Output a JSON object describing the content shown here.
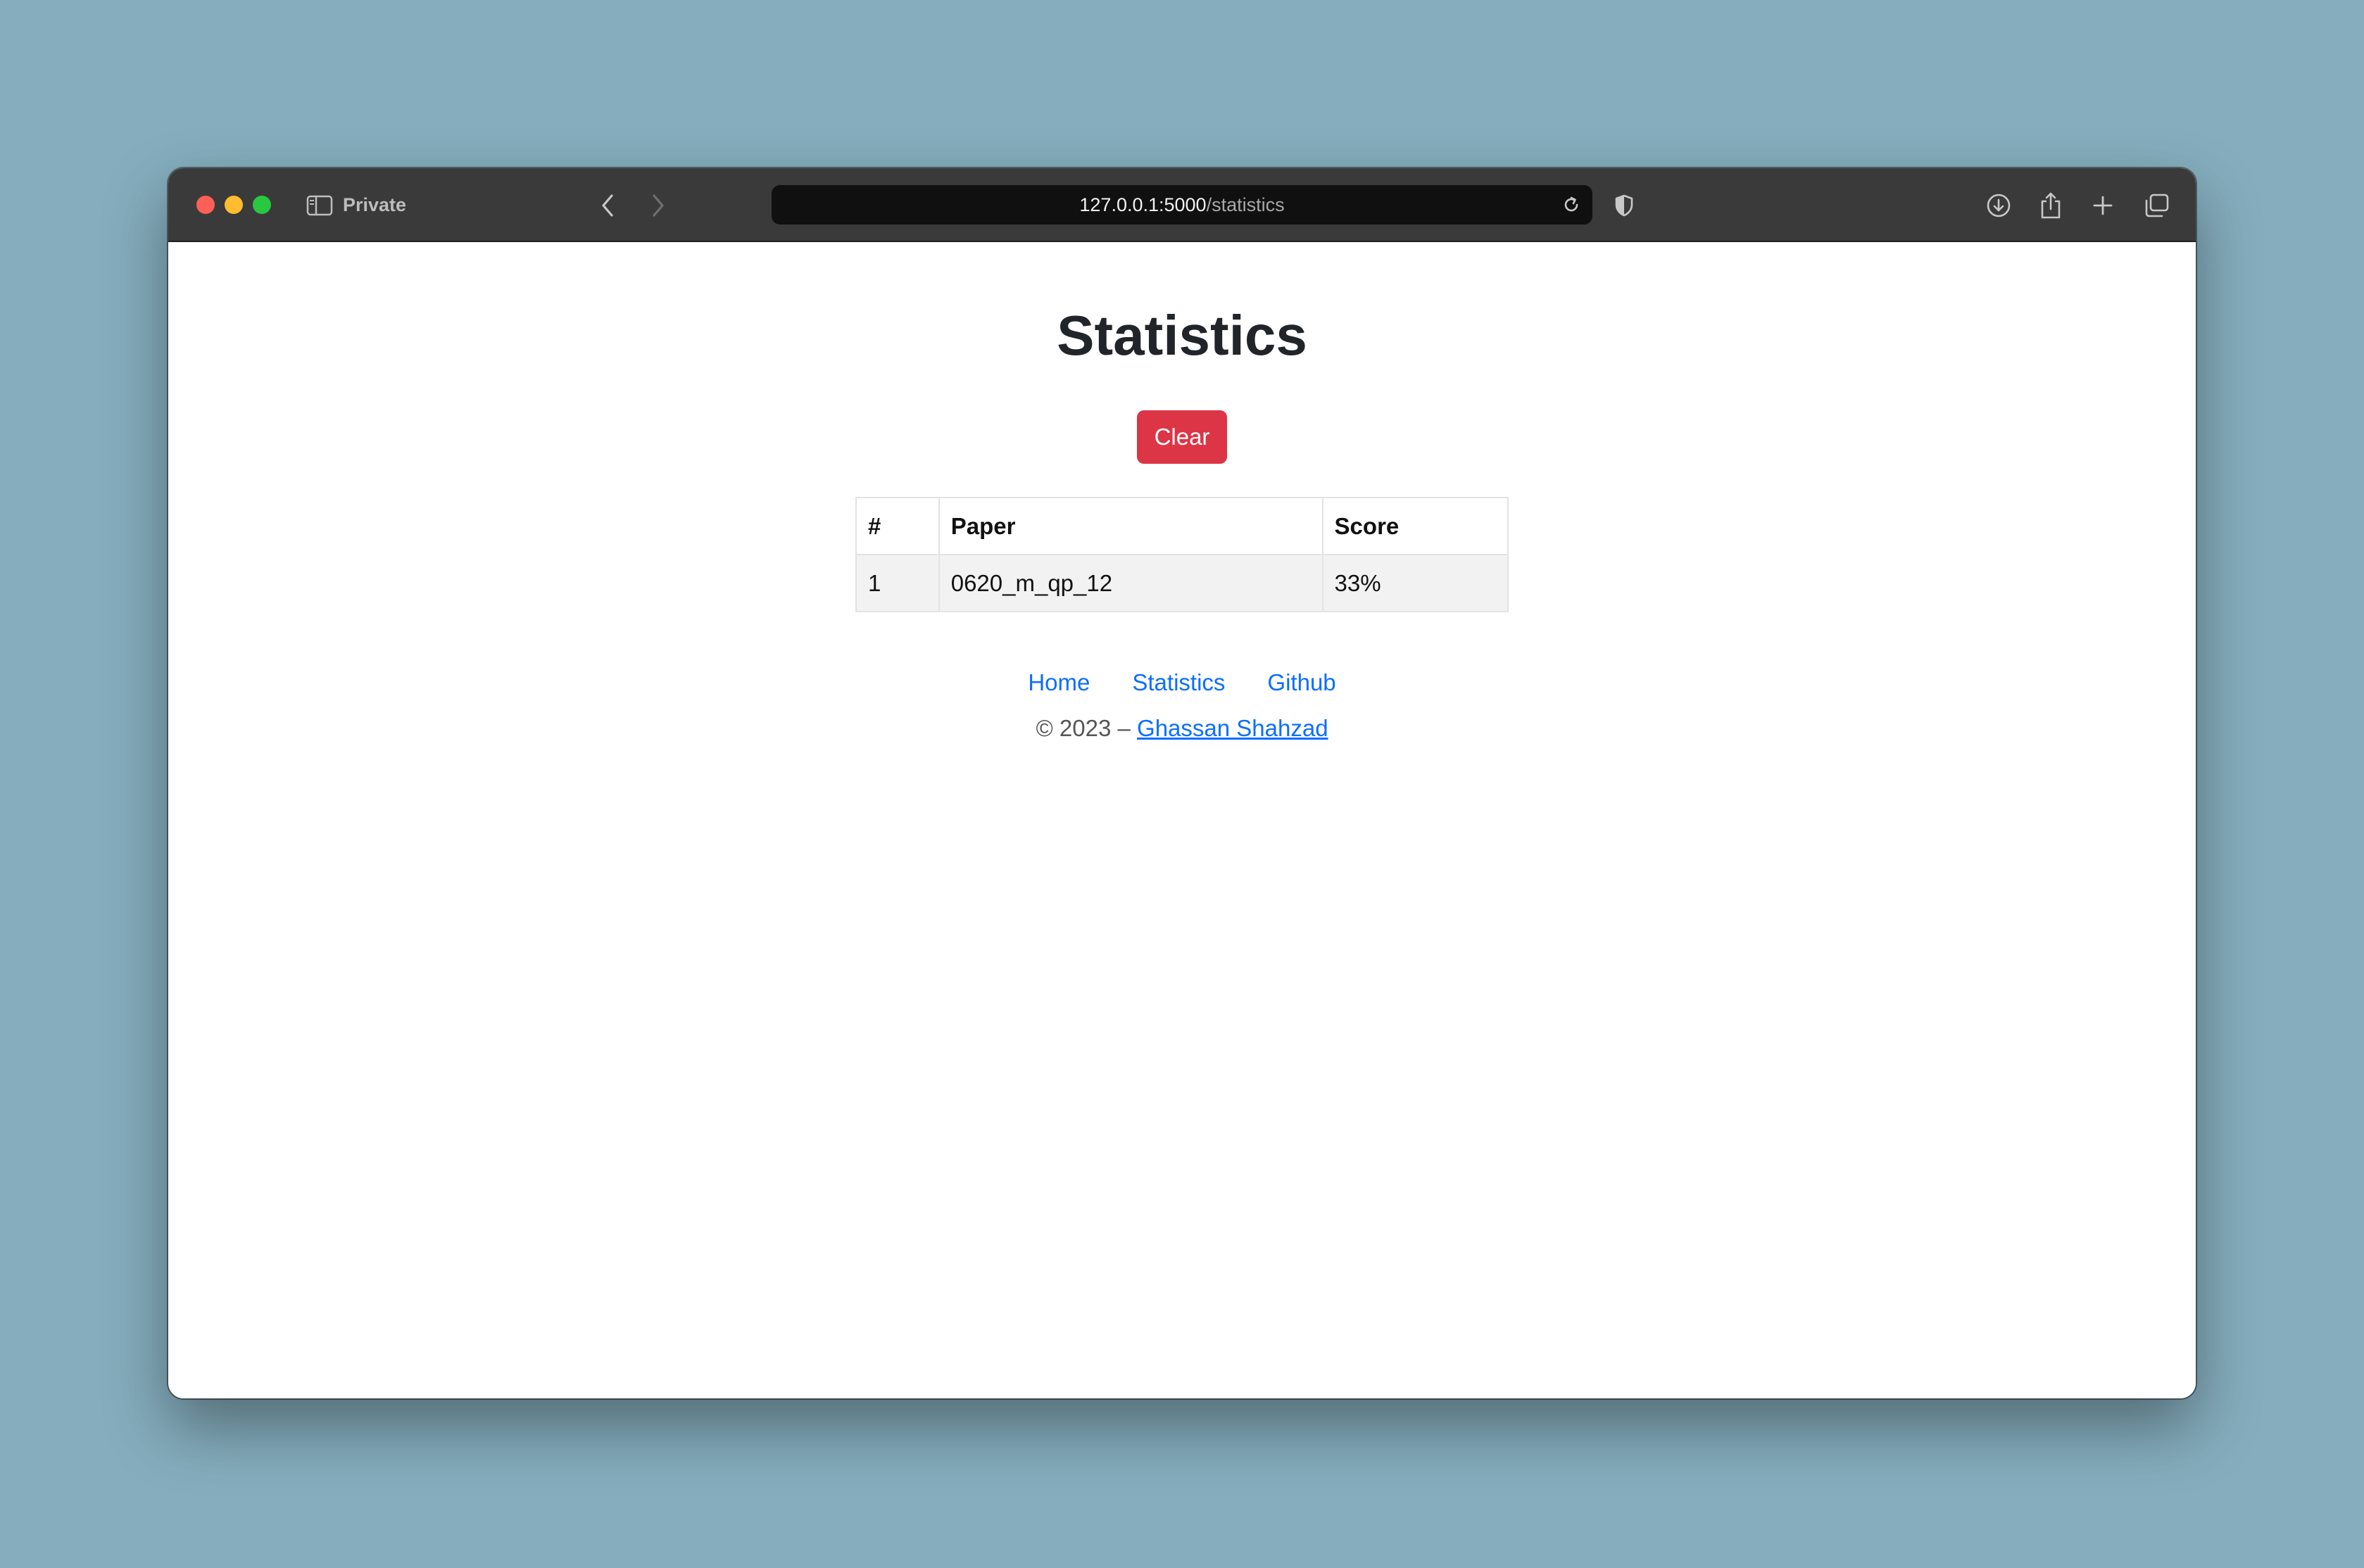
{
  "browser": {
    "mode_label": "Private",
    "url_host": "127.0.0.1:5000",
    "url_path": "/statistics"
  },
  "page": {
    "title": "Statistics",
    "clear_label": "Clear"
  },
  "table": {
    "headers": [
      "#",
      "Paper",
      "Score"
    ],
    "rows": [
      [
        "1",
        "0620_m_qp_12",
        "33%"
      ]
    ]
  },
  "footer": {
    "nav": [
      "Home",
      "Statistics",
      "Github"
    ],
    "copyright_prefix": "© 2023 –",
    "author": "Ghassan Shahzad"
  },
  "colors": {
    "background": "#85adbd",
    "danger": "#dc3545",
    "link": "#0d6efd",
    "toolbar": "#3a3a3a"
  }
}
